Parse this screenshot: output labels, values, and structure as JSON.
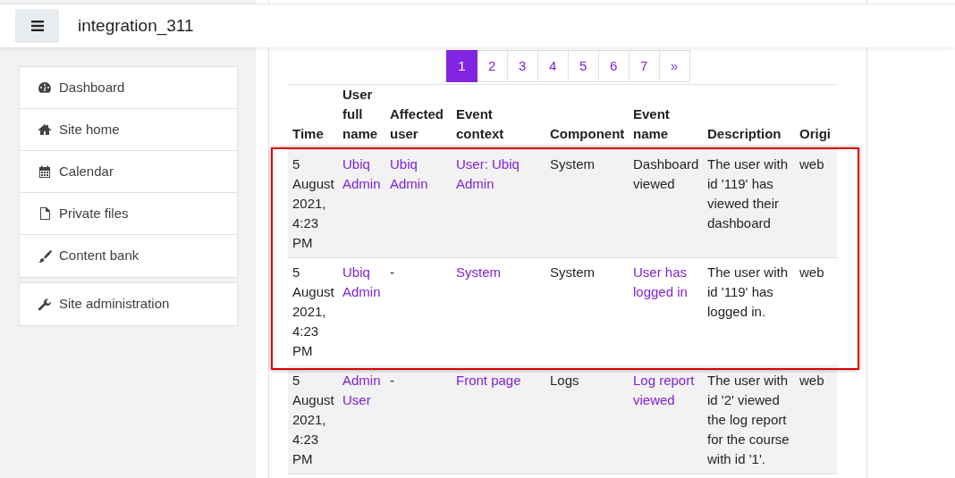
{
  "navbar": {
    "title": "integration_311"
  },
  "sidebar": {
    "groups": [
      [
        {
          "label": "Dashboard"
        },
        {
          "label": "Site home"
        },
        {
          "label": "Calendar"
        },
        {
          "label": "Private files"
        },
        {
          "label": "Content bank"
        }
      ],
      [
        {
          "label": "Site administration"
        }
      ]
    ]
  },
  "pagination": [
    {
      "label": "1",
      "selected": true
    },
    {
      "label": "2",
      "selected": false
    },
    {
      "label": "3",
      "selected": false
    },
    {
      "label": "4",
      "selected": false
    },
    {
      "label": "5",
      "selected": false
    },
    {
      "label": "6",
      "selected": false
    },
    {
      "label": "7",
      "selected": false
    },
    {
      "label": "»",
      "selected": false
    }
  ],
  "table": {
    "columns": [
      "Time",
      "User full name",
      "Affected user",
      "Event context",
      "Component",
      "Event name",
      "Description",
      "Origi"
    ],
    "rows": [
      {
        "highlighted": true,
        "cells": [
          {
            "text": "5 August 2021, 4:23 PM",
            "link": false
          },
          {
            "text": "Ubiq Admin",
            "link": true
          },
          {
            "text": "Ubiq Admin",
            "link": true
          },
          {
            "text": "User: Ubiq Admin",
            "link": true
          },
          {
            "text": "System",
            "link": false
          },
          {
            "text": "Dashboard viewed",
            "link": false
          },
          {
            "text": "The user with id '119' has viewed their dashboard",
            "link": false
          },
          {
            "text": "web",
            "link": false
          }
        ]
      },
      {
        "highlighted": true,
        "cells": [
          {
            "text": "5 August 2021, 4:23 PM",
            "link": false
          },
          {
            "text": "Ubiq Admin",
            "link": true
          },
          {
            "text": "-",
            "link": false
          },
          {
            "text": "System",
            "link": true
          },
          {
            "text": "System",
            "link": false
          },
          {
            "text": "User has logged in",
            "link": true
          },
          {
            "text": "The user with id '119' has logged in.",
            "link": false
          },
          {
            "text": "web",
            "link": false
          }
        ]
      },
      {
        "highlighted": false,
        "cells": [
          {
            "text": "5 August 2021, 4:23 PM",
            "link": false
          },
          {
            "text": "Admin User",
            "link": true
          },
          {
            "text": "-",
            "link": false
          },
          {
            "text": "Front page",
            "link": true
          },
          {
            "text": "Logs",
            "link": false
          },
          {
            "text": "Log report viewed",
            "link": true
          },
          {
            "text": "The user with id '2' viewed the log report for the course with id '1'.",
            "link": false
          },
          {
            "text": "web",
            "link": false
          }
        ]
      }
    ]
  }
}
